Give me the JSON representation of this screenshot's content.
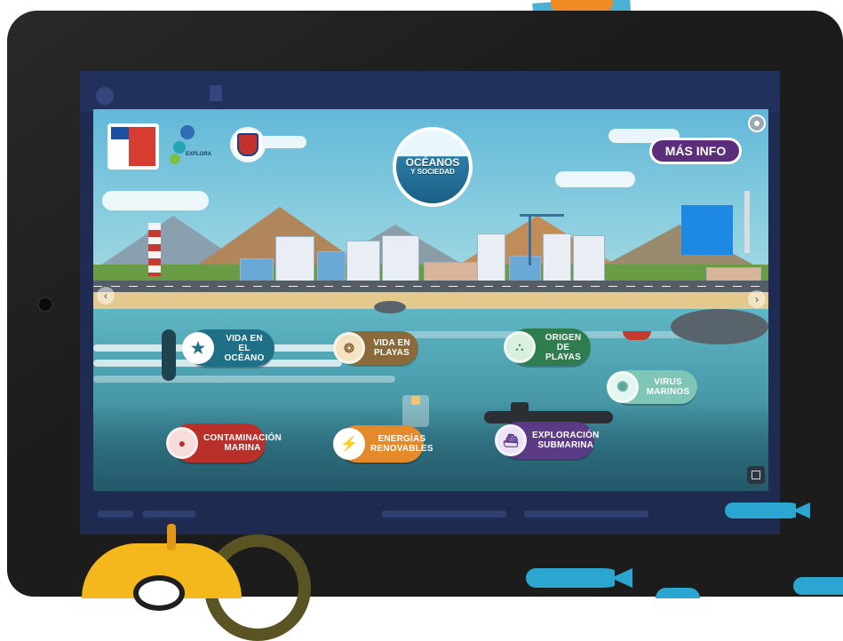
{
  "app": {
    "title": "OCÉANOS Y SOCIEDAD",
    "title_line1": "OCÉANOS",
    "title_line2": "Y SOCIEDAD"
  },
  "header": {
    "mas_info_label": "MÁS INFO",
    "logo_explora": "EXPLORA"
  },
  "nav_buttons": [
    {
      "id": "vida-en-el-oceano",
      "line1": "VIDA EN",
      "line2": "EL OCÉANO",
      "icon": "starfish-icon",
      "color": "#1f6f86"
    },
    {
      "id": "vida-en-playas",
      "line1": "VIDA EN",
      "line2": "PLAYAS",
      "icon": "shell-icon",
      "color": "#8a6a3a"
    },
    {
      "id": "origen-de-playas",
      "line1": "ORIGEN",
      "line2": "DE PLAYAS",
      "icon": "sand-icon",
      "color": "#2e7d4e"
    },
    {
      "id": "virus-marinos",
      "line1": "VIRUS",
      "line2": "MARINOS",
      "icon": "virus-icon",
      "color": "#7fc6b6"
    },
    {
      "id": "contaminacion-marina",
      "line1": "CONTAMINACIÓN",
      "line2": "MARINA",
      "icon": "person-icon",
      "color": "#b9302b"
    },
    {
      "id": "energias-renovables",
      "line1": "ENERGÍAS",
      "line2": "RENOVABLES",
      "icon": "energy-icon",
      "color": "#e58a2b"
    },
    {
      "id": "exploracion-submarina",
      "line1": "EXPLORACIÓN",
      "line2": "SUBMARINA",
      "icon": "submarine-icon",
      "color": "#5b3a86"
    }
  ],
  "colors": {
    "tablet_frame": "#1c1c1c",
    "mas_info_bg": "#5b2d7a",
    "accent_blue": "#1e88e5",
    "fish": "#2aa6d0",
    "sun_yellow": "#f4b81c"
  },
  "icons": {
    "top_right": "menu-circle-icon",
    "left_arrow": "chevron-left-icon",
    "right_arrow": "chevron-right-icon",
    "fullscreen": "fullscreen-icon"
  }
}
